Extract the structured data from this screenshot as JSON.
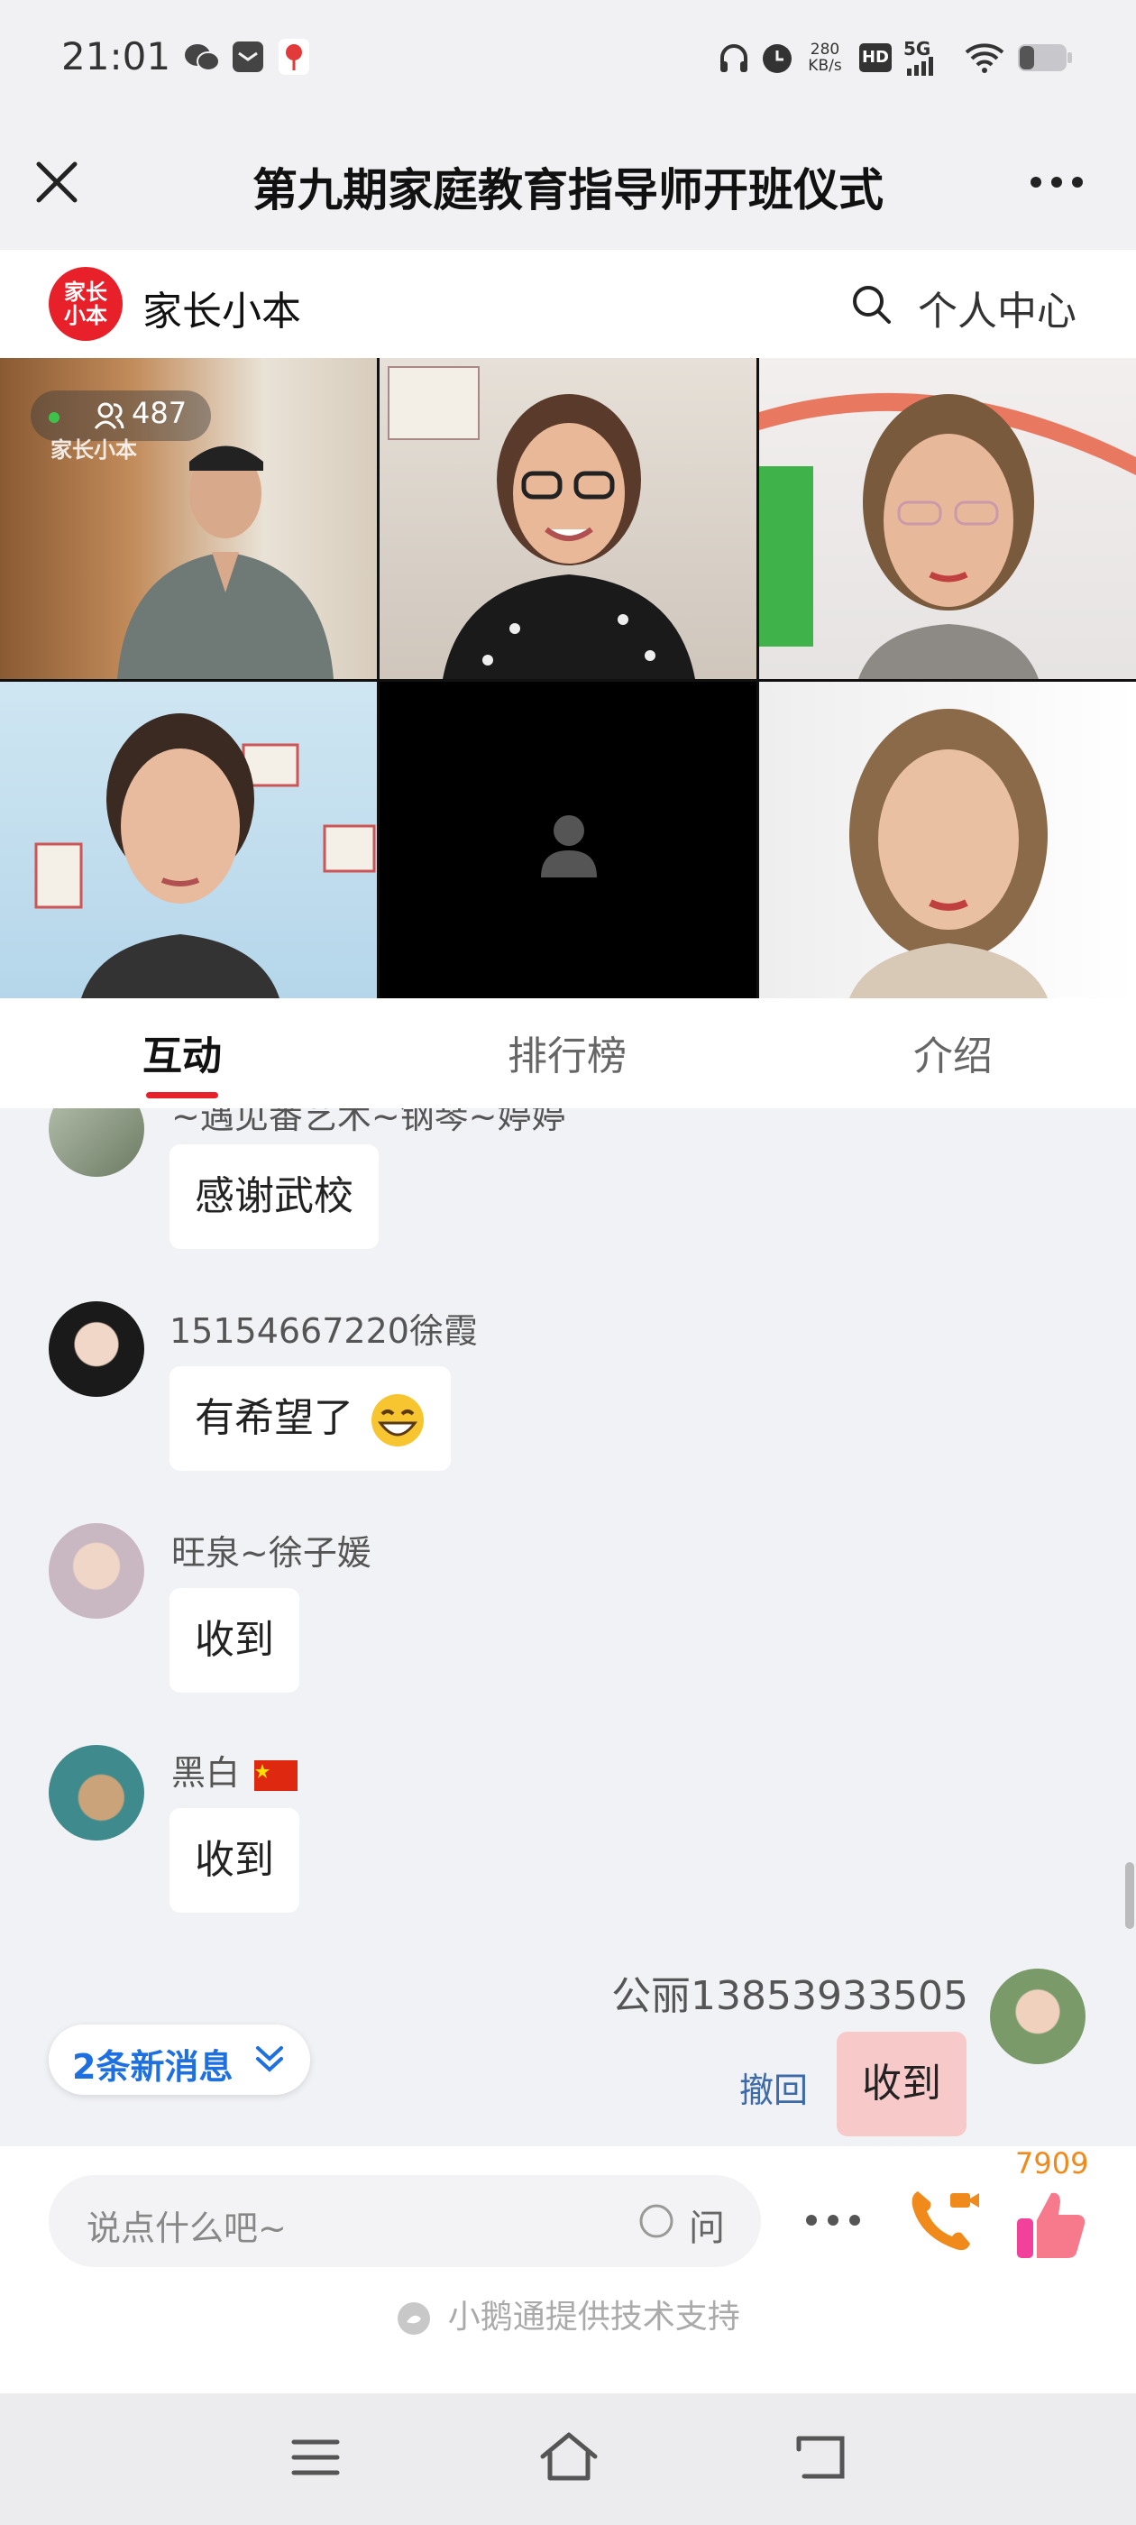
{
  "status_bar": {
    "time": "21:01",
    "net_speed_value": "280",
    "net_speed_unit": "KB/s",
    "hd_label": "HD",
    "network": "5G"
  },
  "title_bar": {
    "title": "第九期家庭教育指导师开班仪式"
  },
  "brand": {
    "logo_line1": "家长",
    "logo_line2": "小本",
    "name": "家长小本",
    "user_center": "个人中心"
  },
  "video": {
    "viewer_count": "487",
    "watermark": "家长小本"
  },
  "tabs": [
    "互动",
    "排行榜",
    "介绍"
  ],
  "chat": {
    "partial_name": "~遇见番艺术~钢琴~婷婷",
    "messages": [
      {
        "name": "",
        "text": "感谢武校"
      },
      {
        "name": "15154667220徐霞",
        "text": "有希望了"
      },
      {
        "name": "旺泉~徐子媛",
        "text": "收到"
      },
      {
        "name": "黑白",
        "text": "收到"
      }
    ],
    "own": {
      "name": "公丽13853933505",
      "text": "收到",
      "recall": "撤回"
    },
    "new_messages": "2条新消息"
  },
  "input": {
    "placeholder": "说点什么吧~",
    "ask_label": "问",
    "like_count": "7909",
    "support_text": "小鹅通提供技术支持"
  },
  "colors": {
    "brand_red": "#e8202a",
    "accent_blue": "#1e6fe0",
    "like_orange": "#f08a1a",
    "bubble_own": "#f7c9c9"
  }
}
